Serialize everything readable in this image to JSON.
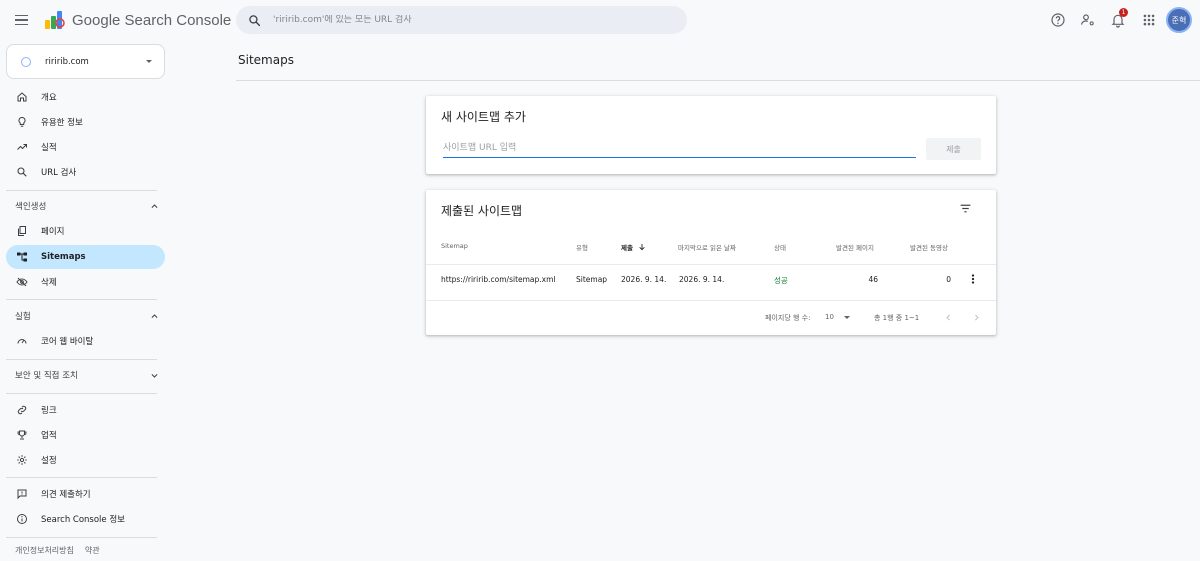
{
  "header": {
    "product_name": "Google Search Console",
    "search_placeholder": "'riririb.com'에 있는 모든 URL 검사",
    "notification_count": "1",
    "avatar_initials": "준혁"
  },
  "sidebar": {
    "property": "riririb.com",
    "nav_top": [
      {
        "label": "개요",
        "icon": "home-icon"
      },
      {
        "label": "유용한 정보",
        "icon": "lightbulb-icon"
      },
      {
        "label": "실적",
        "icon": "trending-up-icon"
      },
      {
        "label": "URL 검사",
        "icon": "search-icon"
      }
    ],
    "section_indexing": "색인생성",
    "nav_indexing": [
      {
        "label": "페이지",
        "icon": "pages-icon"
      },
      {
        "label": "Sitemaps",
        "icon": "sitemap-icon"
      },
      {
        "label": "삭제",
        "icon": "visibility-off-icon"
      }
    ],
    "section_experience": "실험",
    "nav_experience": [
      {
        "label": "코어 웹 바이탈",
        "icon": "speed-icon"
      }
    ],
    "section_security": "보안 및 직접 조치",
    "nav_bottom": [
      {
        "label": "링크",
        "icon": "link-icon"
      },
      {
        "label": "업적",
        "icon": "trophy-icon"
      },
      {
        "label": "설정",
        "icon": "gear-icon"
      }
    ],
    "nav_help": [
      {
        "label": "의견 제출하기",
        "icon": "feedback-icon"
      },
      {
        "label": "Search Console 정보",
        "icon": "info-icon"
      }
    ],
    "footer": {
      "privacy": "개인정보처리방침",
      "terms": "약관"
    }
  },
  "main": {
    "page_title": "Sitemaps",
    "add_card": {
      "title": "새 사이트맵 추가",
      "input_placeholder": "사이트맵 URL 입력",
      "submit_label": "제출"
    },
    "submitted_card": {
      "title": "제출된 사이트맵",
      "columns": [
        "Sitemap",
        "유형",
        "제출",
        "마지막으로 읽은 날짜",
        "상태",
        "발견된 페이지",
        "발견된 동영상"
      ],
      "rows": [
        {
          "sitemap": "https://riririb.com/sitemap.xml",
          "type": "Sitemap",
          "submitted": "2026. 9. 14.",
          "last_read": "2026. 9. 14.",
          "status": "성공",
          "pages": "46",
          "videos": "0"
        }
      ],
      "pagination": {
        "rows_per_page_label": "페이지당 행 수:",
        "rows_per_page": "10",
        "range": "총 1행 중 1~1"
      }
    }
  },
  "colors": {
    "accent": "#1a73e8",
    "active_nav": "#c2e7ff",
    "success": "#188038"
  }
}
